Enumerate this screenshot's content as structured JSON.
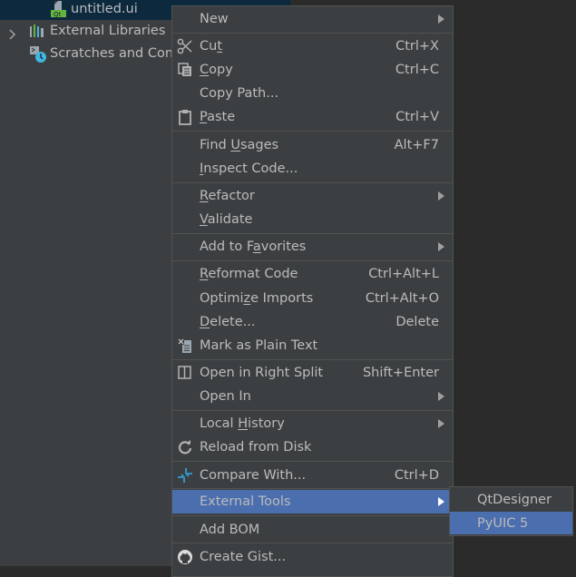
{
  "project_tree": {
    "items": [
      {
        "label": "untitled.ui",
        "icon": "qt-ui-file-icon",
        "selected": true
      },
      {
        "label": "External Libraries",
        "icon": "library-icon",
        "expandable": true
      },
      {
        "label": "Scratches and Con",
        "icon": "scratches-icon"
      }
    ]
  },
  "context_menu": {
    "items": [
      {
        "label": "New",
        "submenu": true
      },
      {
        "label": "Cut",
        "mnemonic_index": 2,
        "shortcut": "Ctrl+X",
        "icon": "scissors-icon"
      },
      {
        "label": "Copy",
        "mnemonic_index": 0,
        "shortcut": "Ctrl+C",
        "icon": "copy-icon"
      },
      {
        "label": "Copy Path...",
        "shortcut": ""
      },
      {
        "label": "Paste",
        "mnemonic_index": 0,
        "shortcut": "Ctrl+V",
        "icon": "clipboard-icon"
      },
      {
        "label": "Find Usages",
        "mnemonic_index": 5,
        "shortcut": "Alt+F7"
      },
      {
        "label": "Inspect Code...",
        "mnemonic_index": 0
      },
      {
        "label": "Refactor",
        "mnemonic_index": 0,
        "submenu": true
      },
      {
        "label": "Validate",
        "mnemonic_index": 0
      },
      {
        "label": "Add to Favorites",
        "mnemonic_index": 8,
        "submenu": true
      },
      {
        "label": "Reformat Code",
        "mnemonic_index": 0,
        "shortcut": "Ctrl+Alt+L"
      },
      {
        "label": "Optimize Imports",
        "mnemonic_index": 6,
        "shortcut": "Ctrl+Alt+O"
      },
      {
        "label": "Delete...",
        "mnemonic_index": 0,
        "shortcut": "Delete"
      },
      {
        "label": "Mark as Plain Text",
        "icon": "plain-text-icon"
      },
      {
        "label": "Open in Right Split",
        "shortcut": "Shift+Enter",
        "icon": "split-icon"
      },
      {
        "label": "Open In",
        "submenu": true
      },
      {
        "label": "Local History",
        "mnemonic_index": 6,
        "submenu": true
      },
      {
        "label": "Reload from Disk",
        "icon": "reload-icon"
      },
      {
        "label": "Compare With...",
        "shortcut": "Ctrl+D",
        "icon": "compare-icon"
      },
      {
        "label": "External Tools",
        "submenu": true,
        "active": true
      },
      {
        "label": "Add BOM"
      },
      {
        "label": "Create Gist...",
        "icon": "github-icon"
      }
    ]
  },
  "external_tools_submenu": {
    "items": [
      {
        "label": "QtDesigner"
      },
      {
        "label": "PyUIC 5",
        "active": true
      }
    ]
  },
  "colors": {
    "menu_bg": "#3c3f41",
    "highlight": "#4b6eaf",
    "text": "#bbbbbb",
    "editor_bg": "#2b2b2b",
    "selection_tree": "#0d293e"
  }
}
